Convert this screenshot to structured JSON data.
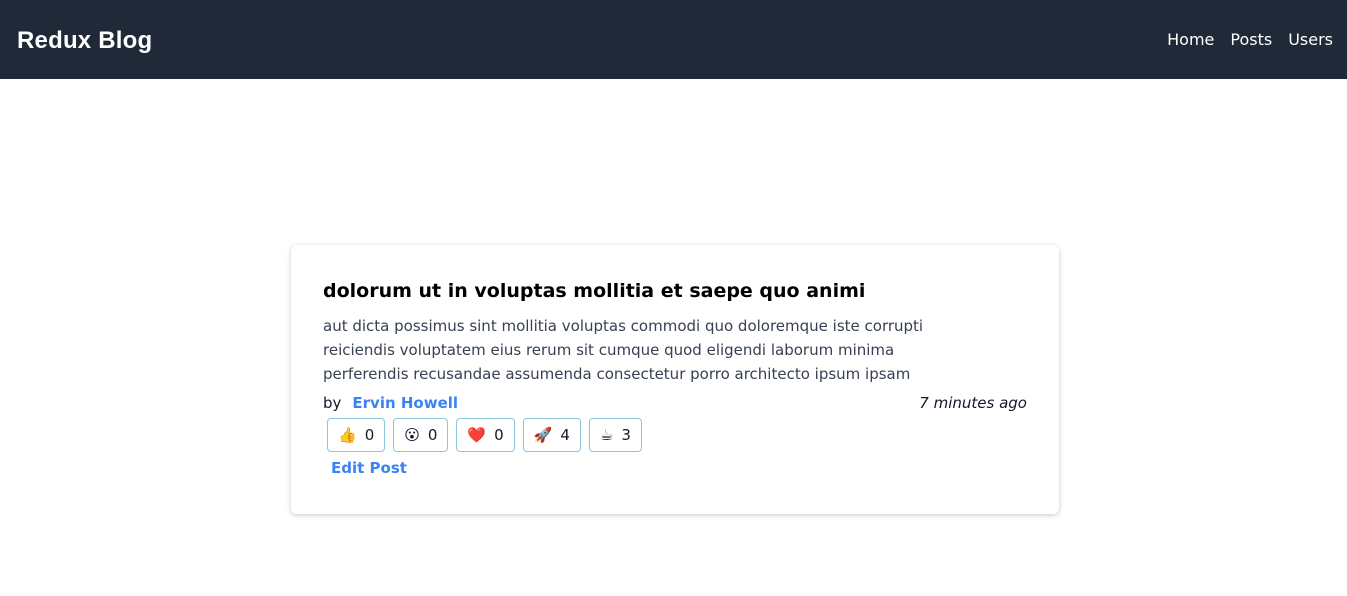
{
  "header": {
    "brand": "Redux Blog",
    "nav": [
      "Home",
      "Posts",
      "Users"
    ],
    "background_color": "#1f2937"
  },
  "post": {
    "title": "dolorum ut in voluptas mollitia et saepe quo animi",
    "body": "aut dicta possimus sint mollitia voluptas commodi quo doloremque iste corrupti reiciendis voluptatem eius rerum sit cumque quod eligendi laborum minima perferendis recusandae assumenda consectetur porro architecto ipsum ipsam",
    "by_label": "by",
    "author": "Ervin Howell",
    "time": "7 minutes ago",
    "reactions": [
      {
        "emoji": "👍",
        "icon": "thumbs-up-icon",
        "count": "0"
      },
      {
        "emoji": "😮",
        "icon": "wow-icon",
        "count": "0"
      },
      {
        "emoji": "❤️",
        "icon": "heart-icon",
        "count": "0"
      },
      {
        "emoji": "🚀",
        "icon": "rocket-icon",
        "count": "4"
      },
      {
        "emoji": "☕",
        "icon": "coffee-icon",
        "count": "3"
      }
    ],
    "edit_label": "Edit Post",
    "link_color": "#3b82f6"
  }
}
